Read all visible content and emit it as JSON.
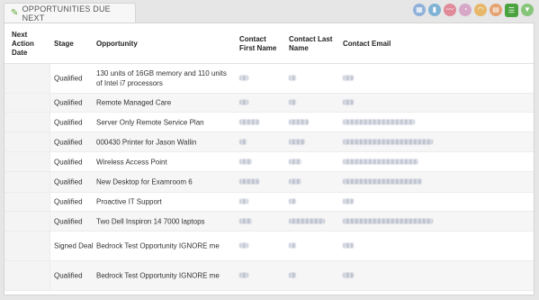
{
  "tab": {
    "title": "OPPORTUNITIES DUE NEXT",
    "icon": "pencil-icon"
  },
  "toolbar": [
    {
      "icon": "table-icon",
      "color": "#8fb1d9"
    },
    {
      "icon": "bar-chart-icon",
      "color": "#7fb2d4"
    },
    {
      "icon": "line-chart-icon",
      "color": "#e08a9a"
    },
    {
      "icon": "pie-chart-icon",
      "color": "#d7a7c8"
    },
    {
      "icon": "gauge-icon",
      "color": "#e8b86a"
    },
    {
      "icon": "grid-icon",
      "color": "#e4a272"
    },
    {
      "icon": "list-icon",
      "color": "#4aa33e",
      "active": true
    },
    {
      "icon": "funnel-icon",
      "color": "#86c57a"
    }
  ],
  "columns": {
    "next_action_date": "Next Action Date",
    "stage": "Stage",
    "opportunity": "Opportunity",
    "contact_first": "Contact First Name",
    "contact_last": "Contact Last Name",
    "contact_email": "Contact Email"
  },
  "rows": [
    {
      "stage": "Qualified",
      "opportunity": "130 units of 16GB memory and 110 units of Intel i7 processors"
    },
    {
      "stage": "Qualified",
      "opportunity": "Remote Managed Care"
    },
    {
      "stage": "Qualified",
      "opportunity": "Server Only Remote Service Plan"
    },
    {
      "stage": "Qualified",
      "opportunity": "000430 Printer for Jason Wallin"
    },
    {
      "stage": "Qualified",
      "opportunity": "Wireless Access Point"
    },
    {
      "stage": "Qualified",
      "opportunity": "New Desktop for Examroom 6"
    },
    {
      "stage": "Qualified",
      "opportunity": "Proactive IT Support"
    },
    {
      "stage": "Qualified",
      "opportunity": "Two Dell Inspiron 14 7000 laptops"
    },
    {
      "stage": "Signed Deal",
      "opportunity": "Bedrock Test Opportunity IGNORE me"
    },
    {
      "stage": "Qualified",
      "opportunity": "Bedrock Test Opportunity IGNORE me"
    }
  ]
}
